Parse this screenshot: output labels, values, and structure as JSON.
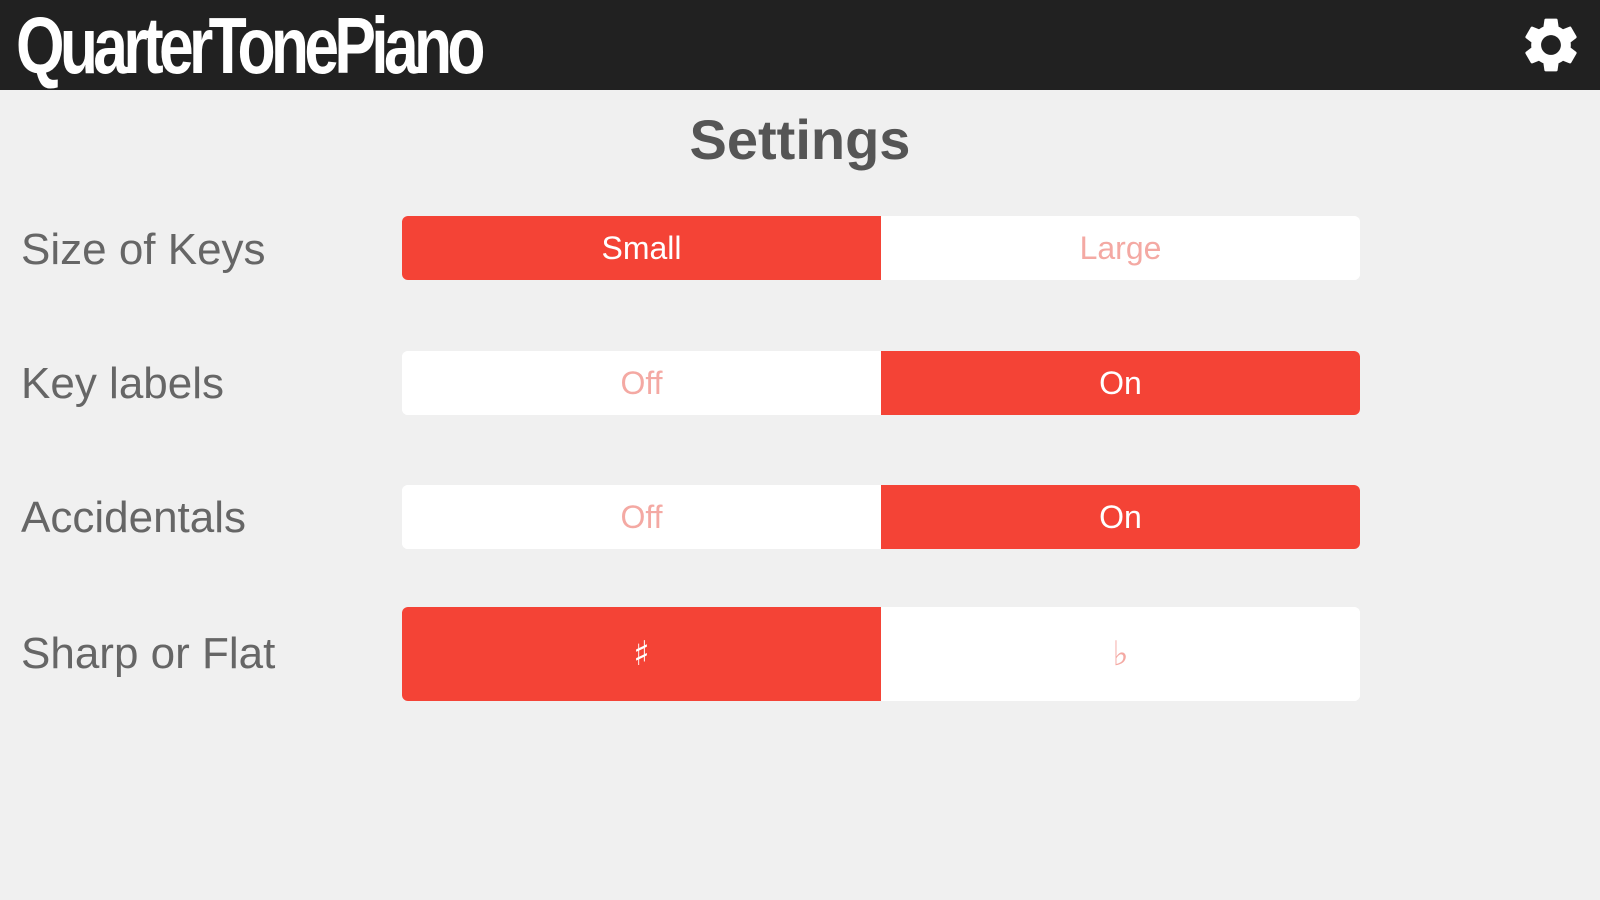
{
  "app": {
    "title": "QuarterTonePiano",
    "settings_icon": "gear-icon",
    "colors": {
      "topbar": "#212121",
      "accent": "#f44336",
      "inactive_text": "#f4a9a3",
      "background": "#f0f0f0"
    }
  },
  "page": {
    "title": "Settings"
  },
  "settings": [
    {
      "label": "Size of Keys",
      "options": [
        "Small",
        "Large"
      ],
      "selected": "Small"
    },
    {
      "label": "Key labels",
      "options": [
        "Off",
        "On"
      ],
      "selected": "On"
    },
    {
      "label": "Accidentals",
      "options": [
        "Off",
        "On"
      ],
      "selected": "On"
    },
    {
      "label": "Sharp or Flat",
      "options": [
        "♯",
        "♭"
      ],
      "selected": "♯"
    }
  ]
}
